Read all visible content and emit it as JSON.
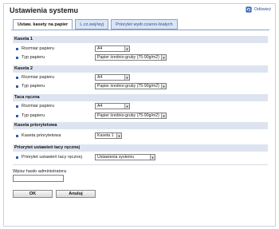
{
  "header": {
    "title": "Ustawienia systemu",
    "refresh_label": "Odśwież"
  },
  "tabs": [
    {
      "label": "Ustaw. kasety na papier"
    },
    {
      "label": "L.cz.wej/wyj"
    },
    {
      "label": "Priorytet wydr.czarno-białych"
    }
  ],
  "sections": {
    "kaseta1": {
      "title": "Kaseta 1",
      "rows": [
        {
          "label": "Rozmiar papieru",
          "value": "A4"
        },
        {
          "label": "Typ papieru",
          "value": "Papier średnio-gruby (75-90g/m2)"
        }
      ]
    },
    "kaseta2": {
      "title": "Kaseta 2",
      "rows": [
        {
          "label": "Rozmiar papieru",
          "value": "A4"
        },
        {
          "label": "Typ papieru",
          "value": "Papier średnio-gruby (75-90g/m2)"
        }
      ]
    },
    "taca": {
      "title": "Taca ręczna",
      "rows": [
        {
          "label": "Rozmiar papieru",
          "value": "A4"
        },
        {
          "label": "Typ papieru",
          "value": "Papier średnio-gruby (75-90g/m2)"
        }
      ]
    },
    "priorytet": {
      "title": "Kaseta priorytetowa",
      "rows": [
        {
          "label": "Kaseta priorytetowa",
          "value": "Kaseta 1"
        }
      ]
    },
    "taca_prior": {
      "title": "Priorytet ustawień tacy ręcznej",
      "rows": [
        {
          "label": "Priorytet ustawień tacy ręcznej",
          "value": "Ustawienia systemu"
        }
      ]
    }
  },
  "password": {
    "label": "Wpisz hasło administratora",
    "value": ""
  },
  "buttons": {
    "ok": "OK",
    "cancel": "Anuluj"
  },
  "colors": {
    "section_bg": "#dde4ef",
    "tab_bg": "#dbe5f4",
    "link": "#2c4f9e",
    "bullet": "#2f5aa8"
  }
}
